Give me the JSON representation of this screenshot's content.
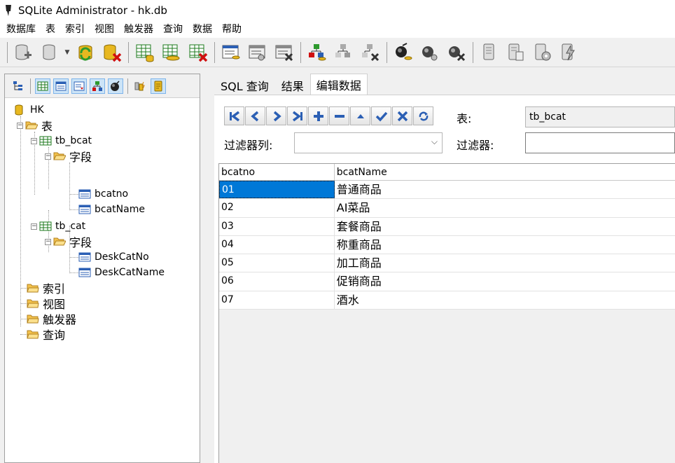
{
  "window": {
    "title": "SQLite Administrator - hk.db"
  },
  "menu": [
    "数据库",
    "表",
    "索引",
    "视图",
    "触发器",
    "查询",
    "数据",
    "帮助"
  ],
  "tree": {
    "root": "HK",
    "tables_label": "表",
    "tables": [
      {
        "name": "tb_bcat",
        "fields_label": "字段",
        "fields": [
          "bcatno",
          "bcatName"
        ]
      },
      {
        "name": "tb_cat",
        "fields_label": "字段",
        "fields": [
          "DeskCatNo",
          "DeskCatName"
        ]
      }
    ],
    "indexes_label": "索引",
    "views_label": "视图",
    "triggers_label": "触发器",
    "queries_label": "查询"
  },
  "tabs": [
    "SQL 查询",
    "结果",
    "编辑数据"
  ],
  "active_tab": "编辑数据",
  "editor": {
    "table_label": "表:",
    "table_value": "tb_bcat",
    "filter_col_label": "过滤器列:",
    "filter_col_value": "",
    "filter_label": "过滤器:",
    "filter_value": ""
  },
  "grid": {
    "columns": [
      "bcatno",
      "bcatName"
    ],
    "rows": [
      [
        "01",
        "普通商品"
      ],
      [
        "02",
        "AI菜品"
      ],
      [
        "03",
        "套餐商品"
      ],
      [
        "04",
        "称重商品"
      ],
      [
        "05",
        "加工商品"
      ],
      [
        "06",
        "促销商品"
      ],
      [
        "07",
        "酒水"
      ]
    ],
    "selected_row": 0
  },
  "colors": {
    "selection": "#0078d7",
    "nav_icon": "#2b5fb4",
    "db_yellow": "#e8b820"
  }
}
